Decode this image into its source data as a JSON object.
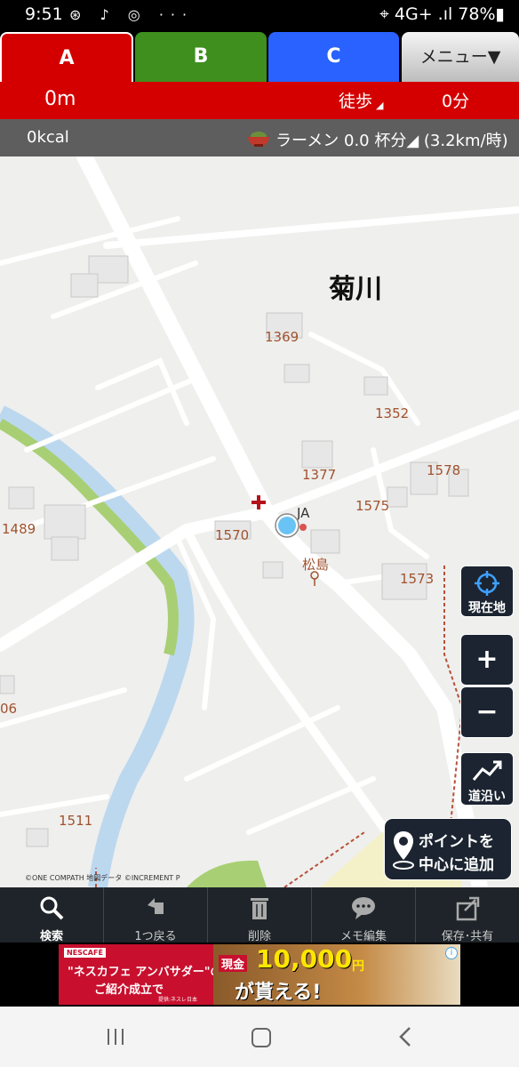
{
  "status": {
    "time": "9:51",
    "left_icons": "⊛ ♪ ◎ ···",
    "right": "⌖ 4G+ .ıl 78%▮"
  },
  "tabs": {
    "a": "A",
    "b": "B",
    "c": "C",
    "menu": "メニュー▼"
  },
  "info": {
    "distance": "0m",
    "mode": "徒歩",
    "mode_marker": "◢",
    "duration": "0分"
  },
  "stats": {
    "kcal": "0kcal",
    "ramen": "ラーメン 0.0 杯分◢ (3.2km/時)"
  },
  "map": {
    "town": "菊川",
    "labels": {
      "l1369": "1369",
      "l1352": "1352",
      "l1377": "1377",
      "l1578": "1578",
      "l1575": "1575",
      "l1489": "1489",
      "l1570": "1570",
      "l1573": "1573",
      "l06": "06",
      "l1511": "1511",
      "matsushima": "松島",
      "ja": "JA"
    },
    "copyright": "©ONE COMPATH 地図データ ©INCREMENT P"
  },
  "buttons": {
    "current_location": "現在地",
    "zoom_in": "+",
    "zoom_out": "−",
    "along_road": "道沿い",
    "add_point_line1": "ポイントを",
    "add_point_line2": "中心に追加"
  },
  "toolbar": {
    "search": "検索",
    "undo": "1つ戻る",
    "delete": "削除",
    "memo": "メモ編集",
    "save": "保存･共有"
  },
  "ad": {
    "brand": "NESCAFÉ",
    "line1": "\"ネスカフェ アンバサダー\"の",
    "line2": "ご紹介成立で",
    "small": "提供:ネスレ日本",
    "genkin": "現金",
    "amount": "10,000",
    "yen": "円",
    "get": "が貰える!",
    "info": "i"
  }
}
